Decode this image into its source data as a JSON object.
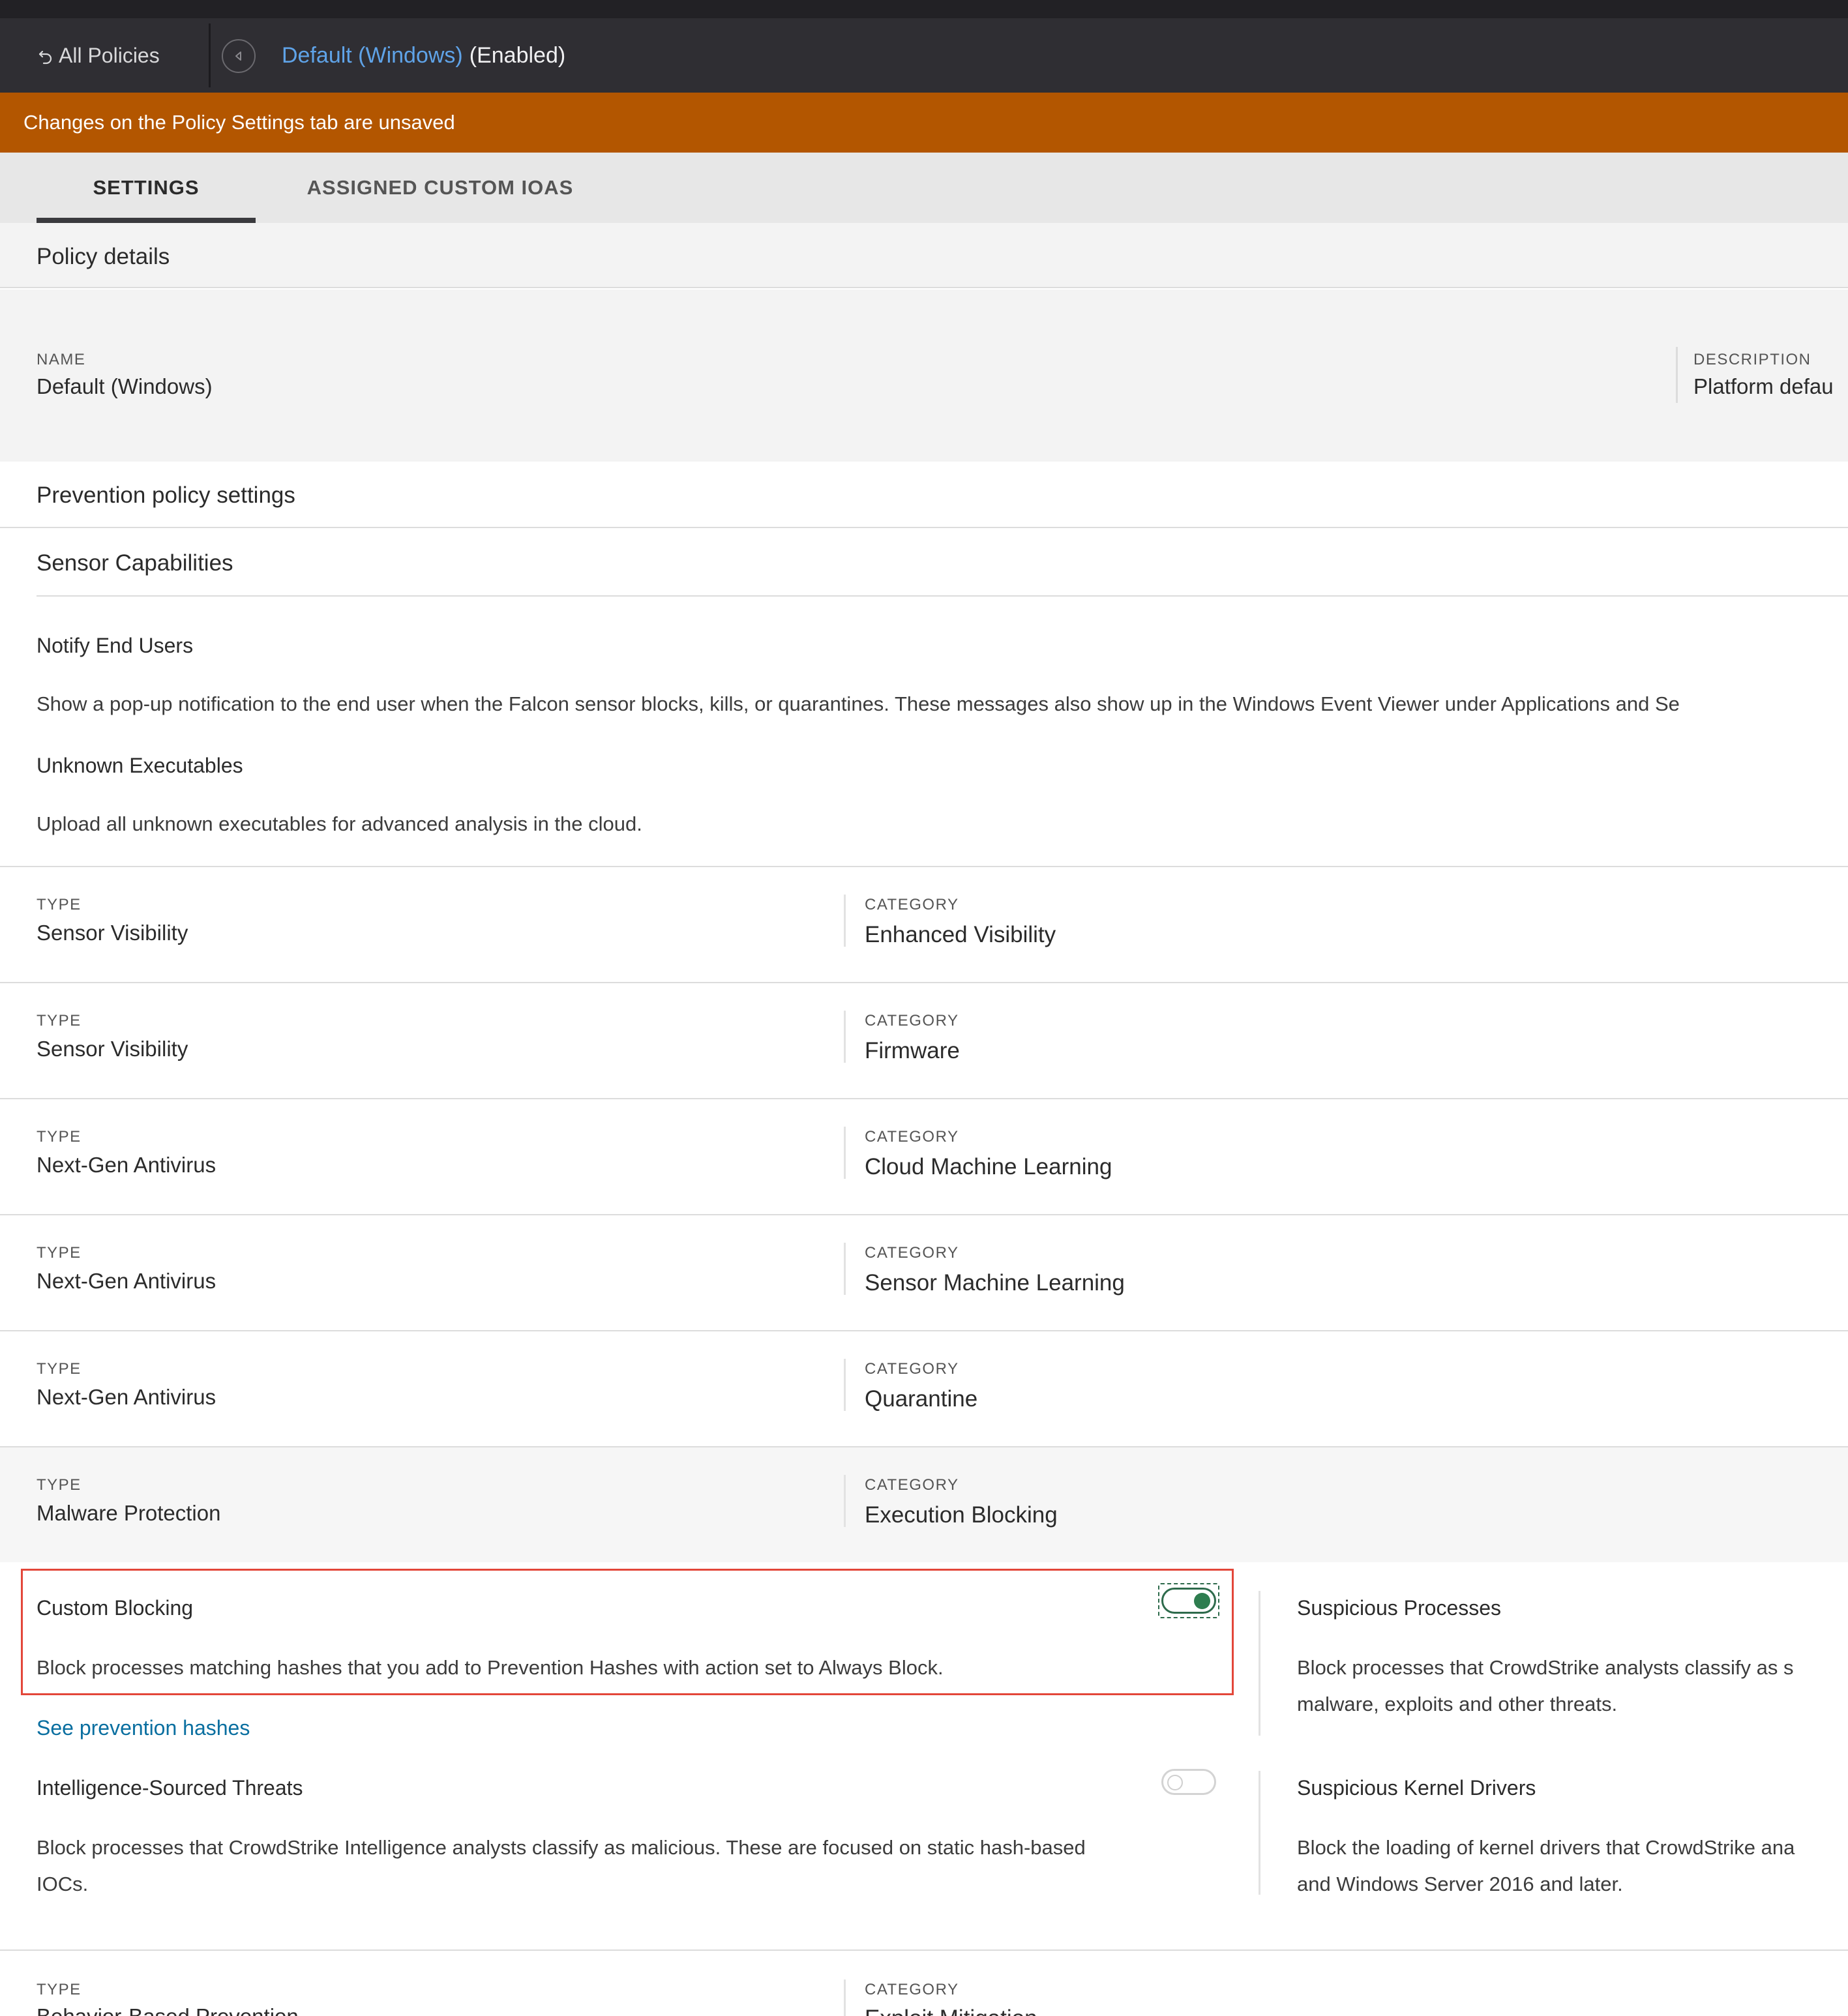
{
  "nav": {
    "back_label": "All Policies",
    "policy_name": "Default (Windows)",
    "policy_state": "(Enabled)"
  },
  "banner": {
    "text": "Changes on the Policy Settings tab are unsaved"
  },
  "tabs": [
    {
      "label": "SETTINGS",
      "active": true
    },
    {
      "label": "ASSIGNED CUSTOM IOAS",
      "active": false
    }
  ],
  "policy_details": {
    "title": "Policy details",
    "name_label": "NAME",
    "name_value": "Default (Windows)",
    "description_label": "DESCRIPTION",
    "description_value": "Platform defau"
  },
  "prevention": {
    "title": "Prevention policy settings",
    "sensor_capabilities_title": "Sensor Capabilities",
    "notify": {
      "title": "Notify End Users",
      "description": "Show a pop-up notification to the end user when the Falcon sensor blocks, kills, or quarantines. These messages also show up in the Windows Event Viewer under Applications and Se"
    },
    "unknown": {
      "title": "Unknown Executables",
      "description": "Upload all unknown executables for advanced analysis in the cloud."
    }
  },
  "rows": [
    {
      "type_label": "TYPE",
      "type": "Sensor Visibility",
      "category_label": "CATEGORY",
      "category": "Enhanced Visibility"
    },
    {
      "type_label": "TYPE",
      "type": "Sensor Visibility",
      "category_label": "CATEGORY",
      "category": "Firmware"
    },
    {
      "type_label": "TYPE",
      "type": "Next-Gen Antivirus",
      "category_label": "CATEGORY",
      "category": "Cloud Machine Learning"
    },
    {
      "type_label": "TYPE",
      "type": "Next-Gen Antivirus",
      "category_label": "CATEGORY",
      "category": "Sensor Machine Learning"
    },
    {
      "type_label": "TYPE",
      "type": "Next-Gen Antivirus",
      "category_label": "CATEGORY",
      "category": "Quarantine"
    },
    {
      "type_label": "TYPE",
      "type": "Malware Protection",
      "category_label": "CATEGORY",
      "category": "Execution Blocking"
    }
  ],
  "execution_blocking": {
    "custom_blocking": {
      "title": "Custom Blocking",
      "description": "Block processes matching hashes that you add to Prevention Hashes with action set to Always Block.",
      "enabled": true
    },
    "see_hashes_link": "See prevention hashes",
    "intel_threats": {
      "title": "Intelligence-Sourced Threats",
      "description_line1": "Block processes that CrowdStrike Intelligence analysts classify as malicious. These are focused on static hash-based",
      "description_line2": "IOCs.",
      "enabled": false
    },
    "suspicious_processes": {
      "title": "Suspicious Processes",
      "description_line1": "Block processes that CrowdStrike analysts classify as s",
      "description_line2": "malware, exploits and other threats."
    },
    "suspicious_kernel": {
      "title": "Suspicious Kernel Drivers",
      "description_line1": "Block the loading of kernel drivers that CrowdStrike ana",
      "description_line2": "and Windows Server 2016 and later."
    }
  },
  "last_row": {
    "type_label": "TYPE",
    "type": "Behavior-Based Prevention",
    "category_label": "CATEGORY",
    "category": "Exploit Mitigation"
  },
  "icons": {
    "back": "undo-arrow-icon",
    "collapse": "circle-left-arrow-icon"
  },
  "colors": {
    "banner": "#b35600",
    "link": "#5fa3e8",
    "toggle_on": "#2e7d4f",
    "highlight": "#e3473a"
  }
}
